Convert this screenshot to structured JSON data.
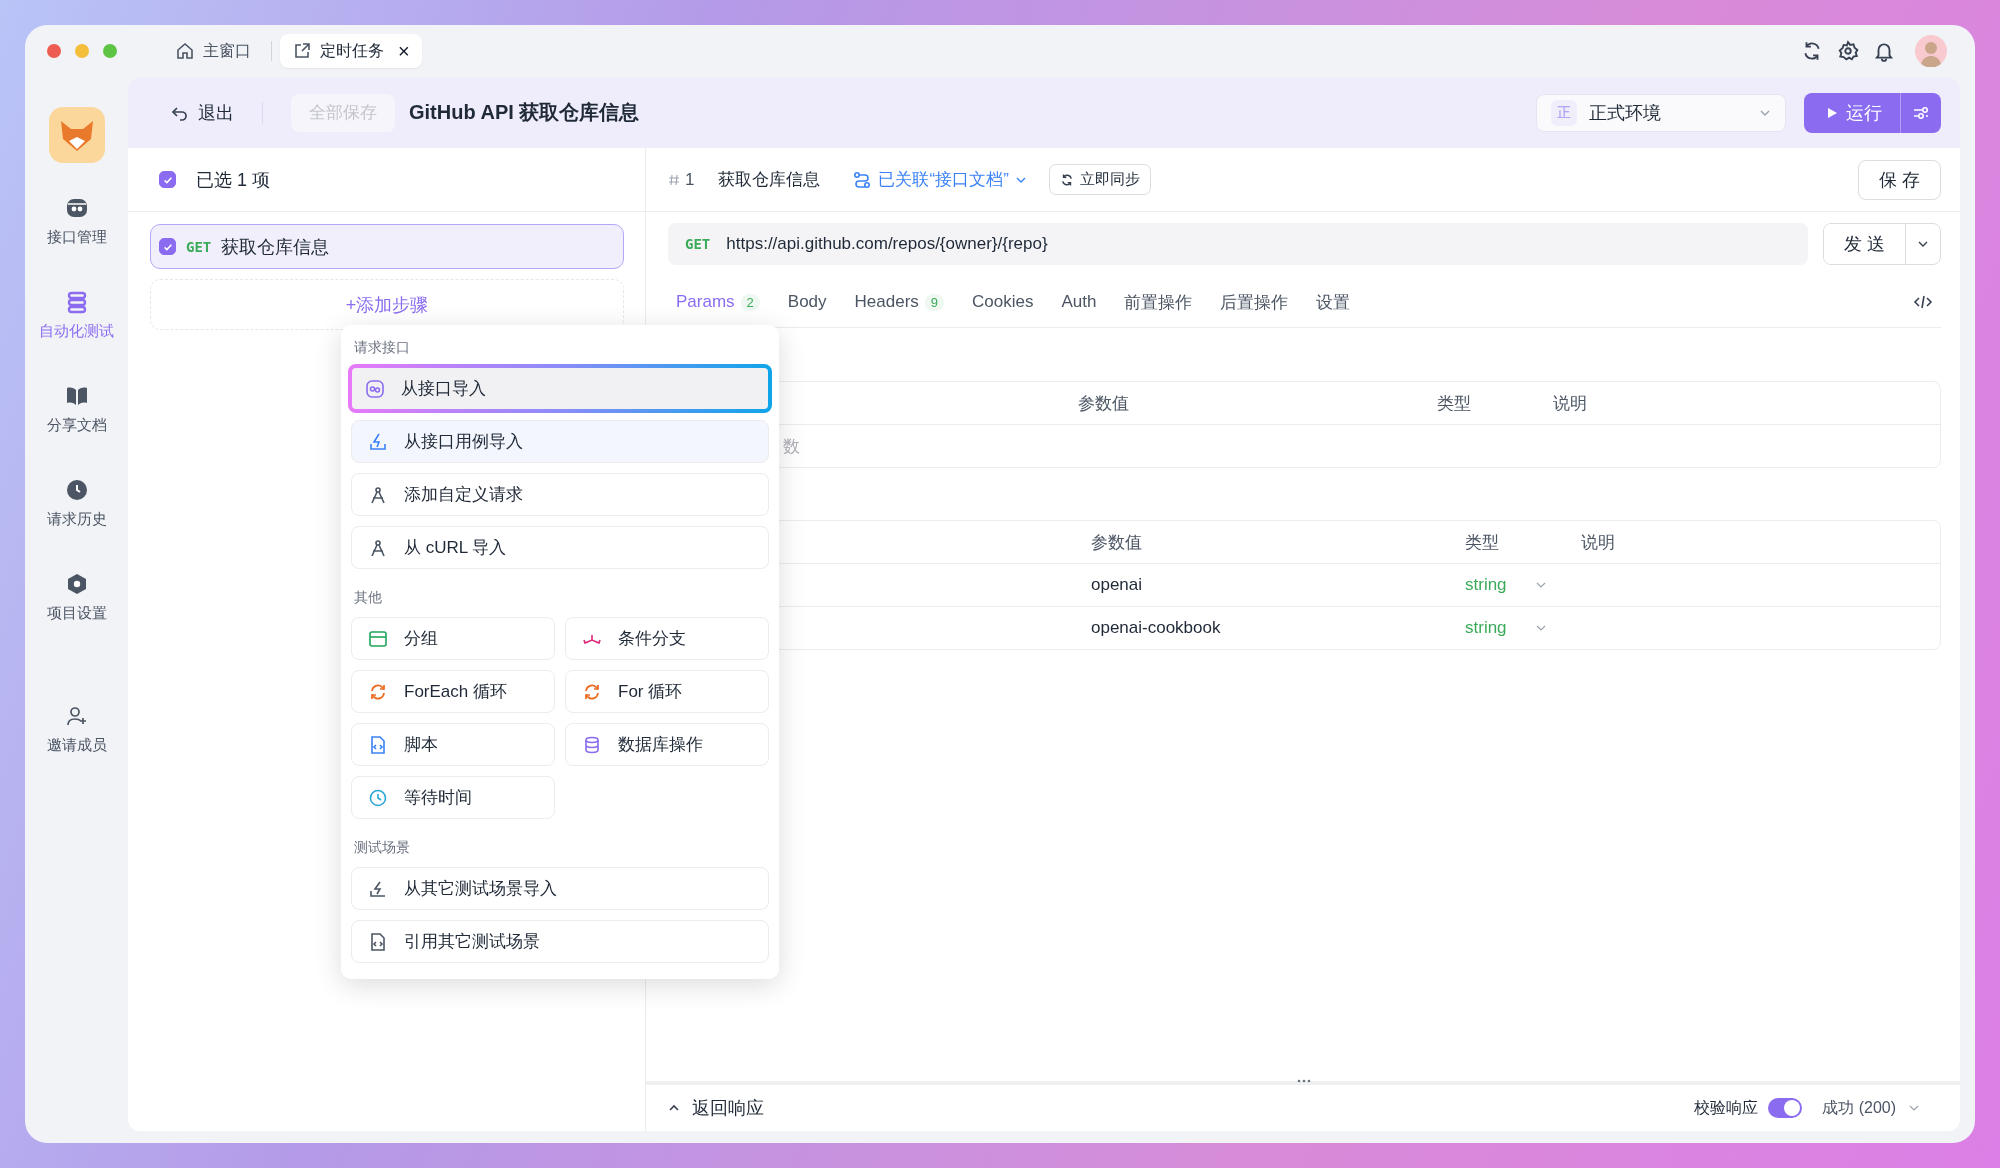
{
  "tabs": [
    {
      "label": "主窗口",
      "selected": false
    },
    {
      "label": "定时任务",
      "selected": true,
      "close": "×"
    }
  ],
  "sidebar": {
    "items": [
      {
        "label": "接口管理",
        "selected": false
      },
      {
        "label": "自动化测试",
        "selected": true
      },
      {
        "label": "分享文档",
        "selected": false
      },
      {
        "label": "请求历史",
        "selected": false
      },
      {
        "label": "项目设置",
        "selected": false
      },
      {
        "label": "邀请成员",
        "selected": false
      }
    ]
  },
  "header": {
    "exit_label": "退出",
    "save_all": {
      "label": "全部保存",
      "disabled": true
    },
    "title": "GitHub API 获取仓库信息",
    "environment": {
      "badge": "正",
      "value": "正式环境"
    },
    "run_label": "运行"
  },
  "steps": {
    "selected_label": "已选 1 项",
    "all_checked": true,
    "items": [
      {
        "method": "GET",
        "name": "获取仓库信息",
        "checked": true,
        "selected": true
      }
    ],
    "add_label": "+添加步骤"
  },
  "menu": {
    "sections": [
      {
        "title": "请求接口",
        "kind": "list",
        "items": [
          {
            "label": "从接口导入",
            "focused": true,
            "hovered": false
          },
          {
            "label": "从接口用例导入",
            "focused": false,
            "hovered": true
          },
          {
            "label": "添加自定义请求",
            "focused": false,
            "hovered": false
          },
          {
            "label": "从 cURL 导入",
            "focused": false,
            "hovered": false
          }
        ]
      },
      {
        "title": "其他",
        "kind": "grid",
        "items": [
          {
            "label": "分组",
            "focused": false,
            "hovered": false
          },
          {
            "label": "条件分支",
            "focused": false,
            "hovered": false
          },
          {
            "label": "ForEach 循环",
            "focused": false,
            "hovered": false
          },
          {
            "label": "For 循环",
            "focused": false,
            "hovered": false
          },
          {
            "label": "脚本",
            "focused": false,
            "hovered": false
          },
          {
            "label": "数据库操作",
            "focused": false,
            "hovered": false
          },
          {
            "label": "等待时间",
            "focused": false,
            "hovered": false
          }
        ]
      },
      {
        "title": "测试场景",
        "kind": "list",
        "items": [
          {
            "label": "从其它测试场景导入",
            "focused": false,
            "hovered": false
          },
          {
            "label": "引用其它测试场景",
            "focused": false,
            "hovered": false
          }
        ]
      }
    ]
  },
  "request": {
    "index": "1",
    "name": "获取仓库信息",
    "linked_doc": "已关联“接口文档”",
    "sync_label": "立即同步",
    "save_label": "保 存",
    "method": "GET",
    "url": "https://api.github.com/repos/{owner}/{repo}",
    "send_label": "发 送",
    "tabs": [
      {
        "label": "Params",
        "count": "2",
        "selected": true
      },
      {
        "label": "Body",
        "selected": false
      },
      {
        "label": "Headers",
        "count": "9",
        "selected": false
      },
      {
        "label": "Cookies",
        "selected": false
      },
      {
        "label": "Auth",
        "selected": false
      },
      {
        "label": "前置操作",
        "selected": false
      },
      {
        "label": "后置操作",
        "selected": false
      },
      {
        "label": "设置",
        "selected": false
      }
    ]
  },
  "tables": [
    {
      "columns": [
        "参数值",
        "类型",
        "说明"
      ],
      "empty_text": "数"
    },
    {
      "columns": [
        "参数值",
        "类型",
        "说明"
      ],
      "rows": [
        {
          "value": "openai",
          "type": "string"
        },
        {
          "value": "openai-cookbook",
          "type": "string"
        }
      ]
    }
  ],
  "response": {
    "label": "返回响应",
    "expanded": false,
    "validate_label": "校验响应",
    "validate_on": true,
    "status": "成功 (200)"
  }
}
